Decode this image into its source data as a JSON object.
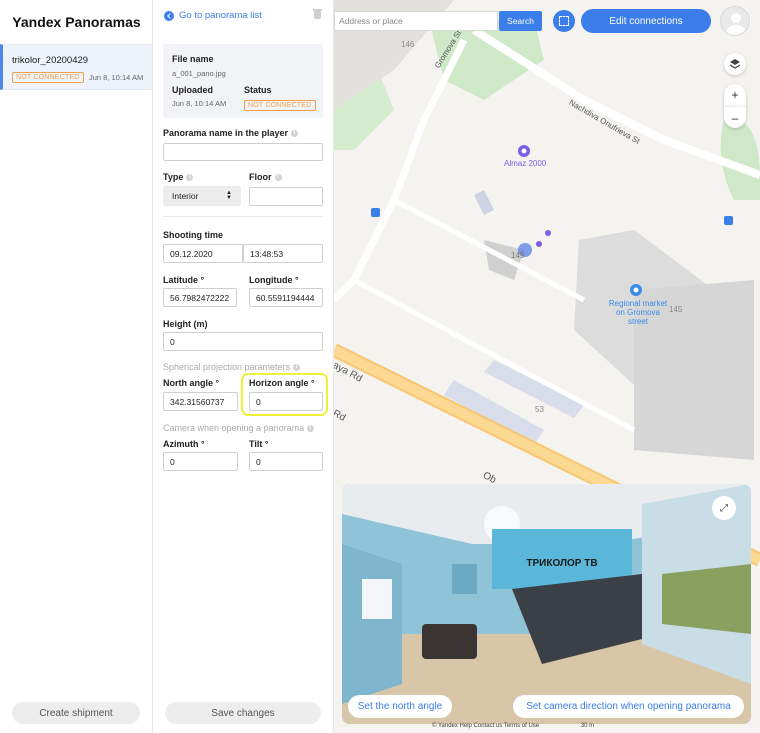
{
  "app": {
    "title": "Yandex Panoramas"
  },
  "list": {
    "items": [
      {
        "name": "trikolor_20200429",
        "status": "NOT CONNECTED",
        "date": "Jun 8, 10:14 AM"
      }
    ],
    "create_label": "Create shipment"
  },
  "form": {
    "back_label": "Go to panorama list",
    "file": {
      "name_label": "File name",
      "name_value": "a_001_pano.jpg",
      "uploaded_label": "Uploaded",
      "uploaded_value": "Jun 8, 10:14 AM",
      "status_label": "Status",
      "status_value": "NOT CONNECTED"
    },
    "panorama_name_label": "Panorama name in the player",
    "panorama_name_value": "",
    "type_label": "Type",
    "type_value": "Interior",
    "floor_label": "Floor",
    "floor_value": "",
    "shooting_time_label": "Shooting time",
    "shooting_date": "09.12.2020",
    "shooting_clock": "13:48:53",
    "latitude_label": "Latitude °",
    "latitude_value": "56.7982472222",
    "longitude_label": "Longitude °",
    "longitude_value": "60.5591194444",
    "height_label": "Height (m)",
    "height_value": "0",
    "spherical_label": "Spherical projection parameters",
    "north_label": "North angle °",
    "north_value": "342.31560737",
    "horizon_label": "Horizon angle °",
    "horizon_value": "0",
    "camera_label": "Camera when opening a panorama",
    "azimuth_label": "Azimuth °",
    "azimuth_value": "0",
    "tilt_label": "Tilt °",
    "tilt_value": "0",
    "save_label": "Save changes"
  },
  "map": {
    "search_placeholder": "Address or place",
    "search_label": "Search",
    "edit_connections_label": "Edit connections",
    "streets": {
      "gromova": "Gromova St",
      "nachdiva": "Nachdiva Onufrieva St",
      "rd1": "aya Rd",
      "rd2": "Rd",
      "ob": "Ob"
    },
    "pois": {
      "almaz": "Almaz 2000",
      "market": "Regional market on Gromova street"
    },
    "house_numbers": [
      "146",
      "149",
      "145",
      "53"
    ],
    "attribution": "© Yandex  Help  Contact us  Terms of Use",
    "scale": "30 m"
  },
  "viewer": {
    "set_north_label": "Set the north angle",
    "set_camera_label": "Set camera direction when opening panorama",
    "sign_text": "ТРИКОЛОР ТВ"
  },
  "icons": {
    "back": "chevron-left-icon",
    "trash": "trash-icon",
    "layers": "layers-icon",
    "expand": "expand-icon"
  },
  "colors": {
    "accent": "#3b7de9",
    "warning": "#f0a04b",
    "highlight": "#f2ef3a",
    "poi": "#7b5de6"
  }
}
